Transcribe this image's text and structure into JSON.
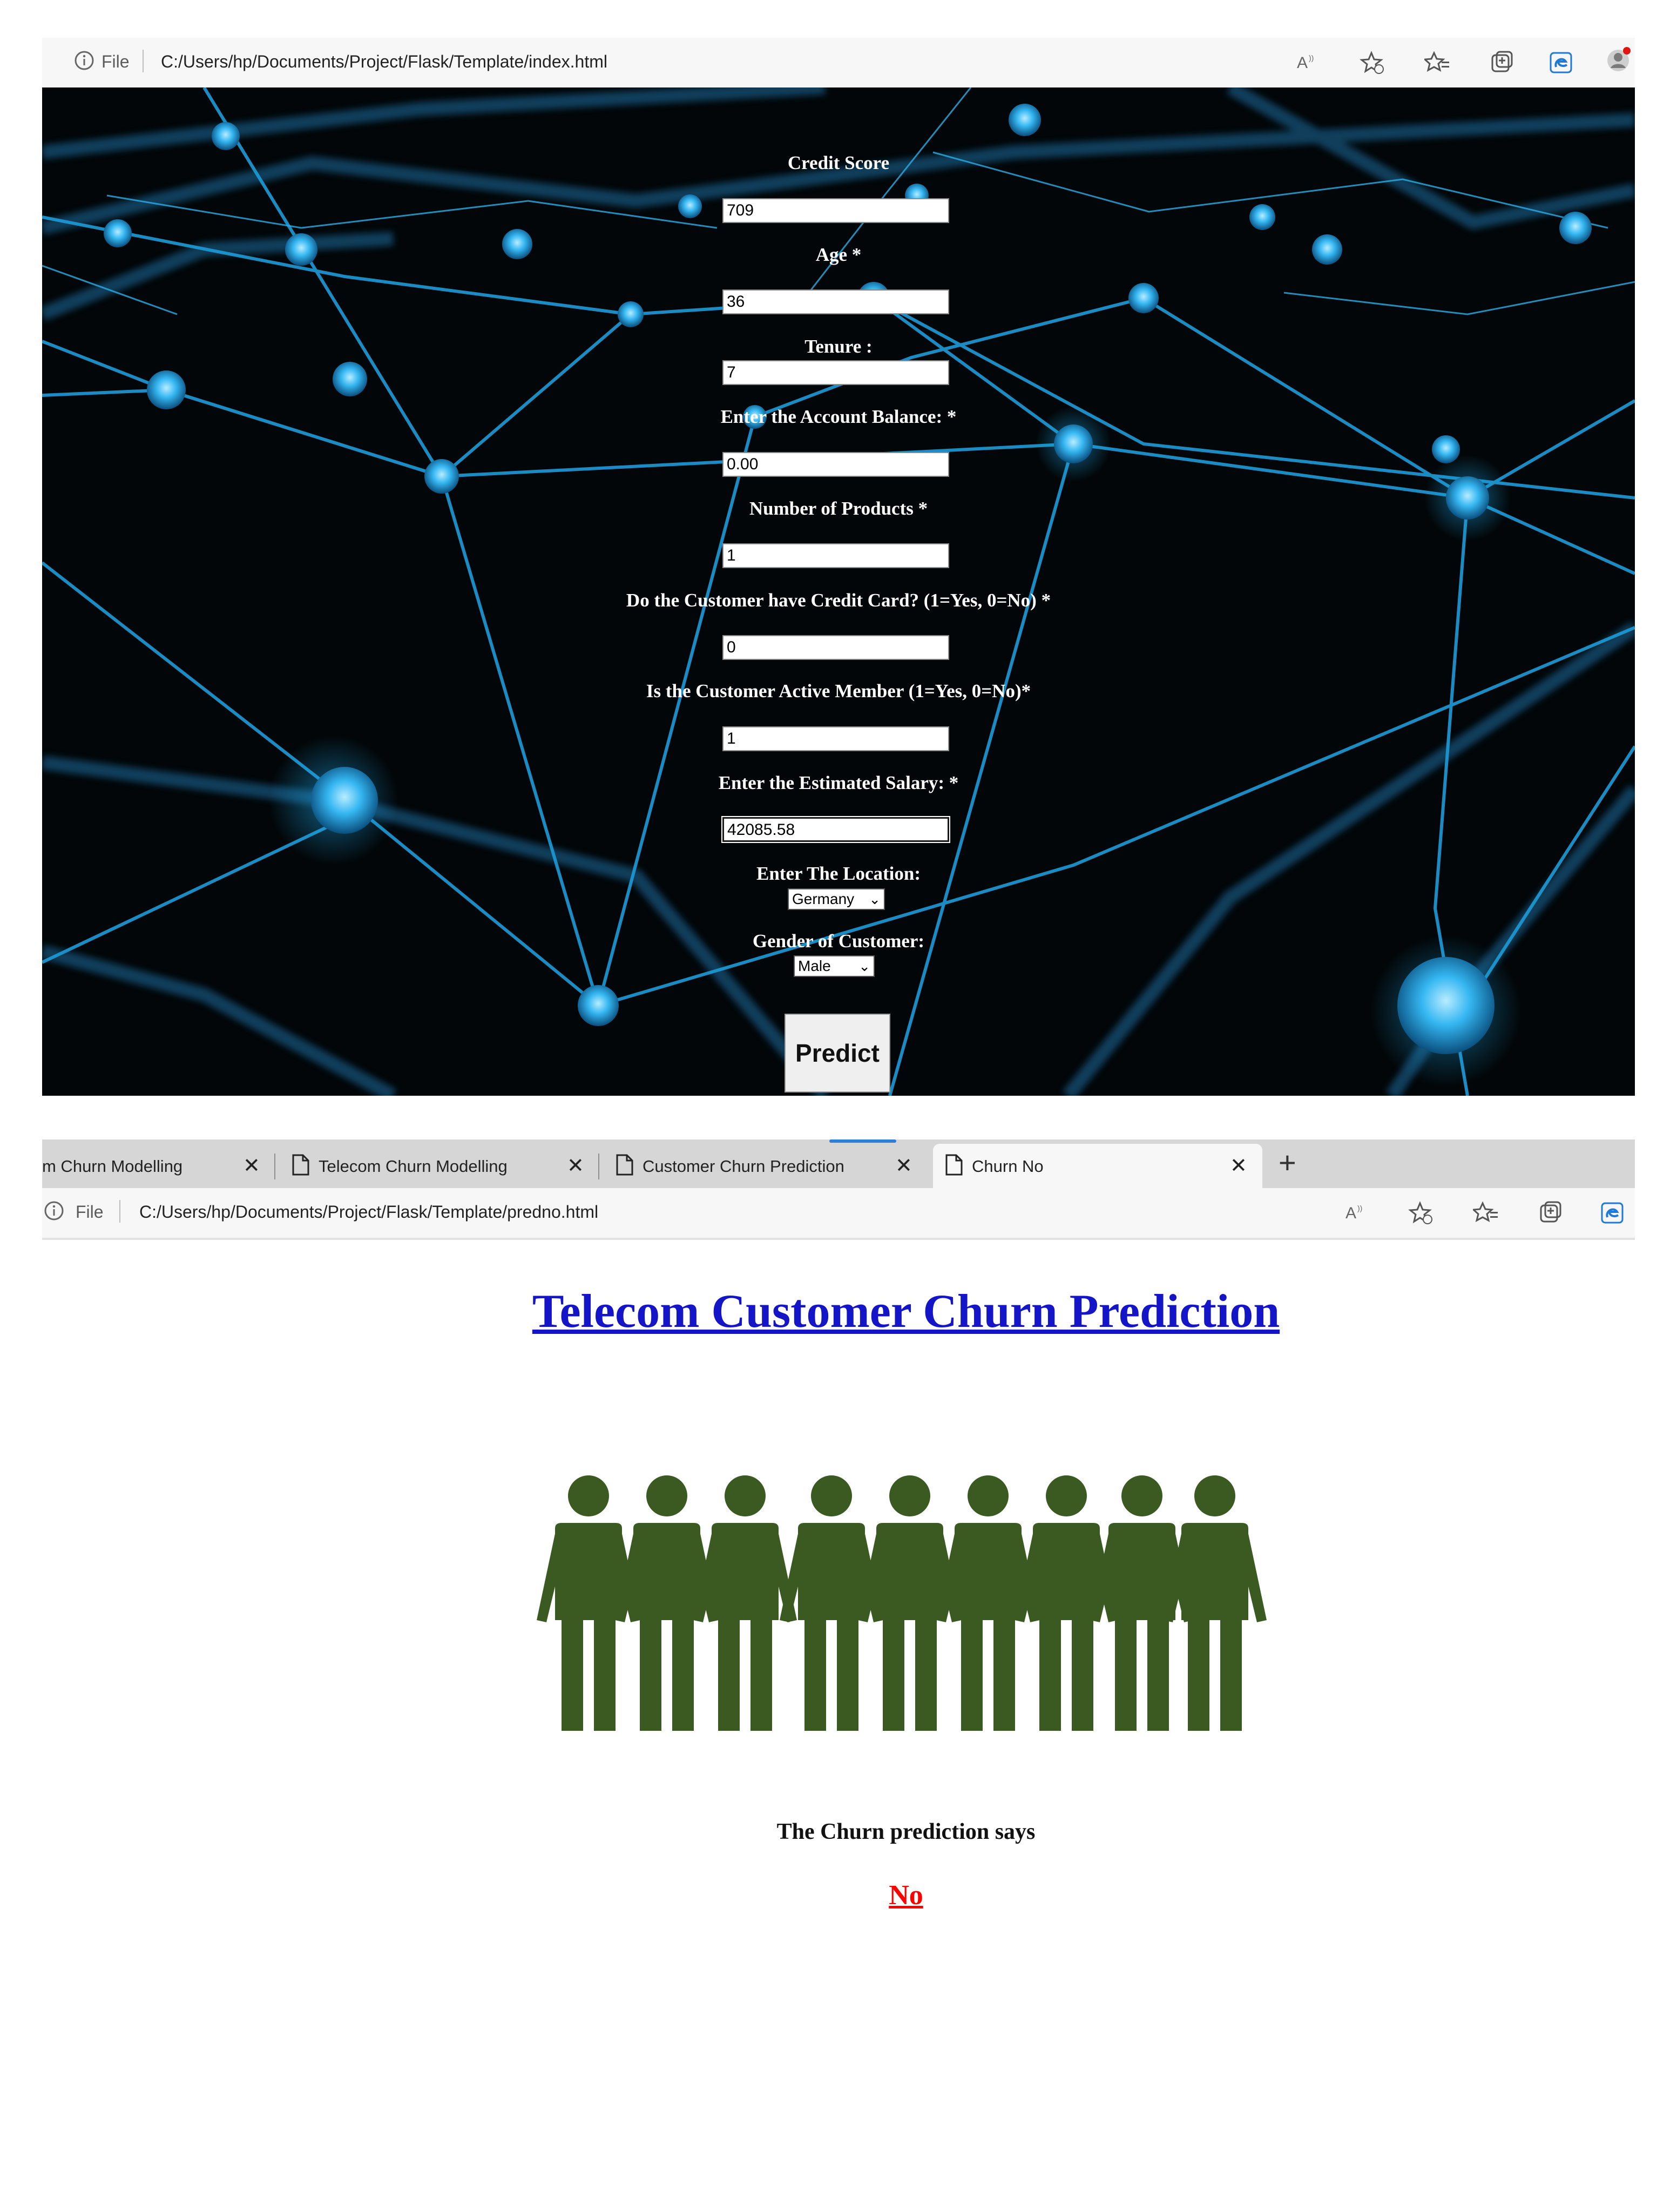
{
  "form_window": {
    "address_bar": {
      "file_label": "File",
      "url": "C:/Users/hp/Documents/Project/Flask/Template/index.html"
    },
    "fields": [
      {
        "label": "Credit Score",
        "value": "709"
      },
      {
        "label": "Age *",
        "value": "36"
      },
      {
        "label": "Tenure :",
        "value": "7"
      },
      {
        "label": "Enter the Account Balance: *",
        "value": "0.00"
      },
      {
        "label": "Number of Products *",
        "value": "1"
      },
      {
        "label": "Do the Customer have Credit Card? (1=Yes, 0=No) *",
        "value": "0"
      },
      {
        "label": "Is the Customer Active Member (1=Yes, 0=No)*",
        "value": "1"
      },
      {
        "label": "Enter the Estimated Salary: *",
        "value": "42085.58"
      }
    ],
    "location": {
      "label": "Enter The Location:",
      "selected": "Germany"
    },
    "gender": {
      "label": "Gender of Customer:",
      "selected": "Male"
    },
    "predict_label": "Predict",
    "toolbar_icons": [
      "read-aloud-icon",
      "add-favorite-icon",
      "favorites-icon",
      "collections-icon",
      "edge-icon",
      "profile-icon"
    ]
  },
  "result_window": {
    "tabs": [
      {
        "title": "m Churn Modelling",
        "active": false
      },
      {
        "title": "Telecom Churn Modelling",
        "active": false
      },
      {
        "title": "Customer Churn Prediction",
        "active": false
      },
      {
        "title": "Churn No",
        "active": true
      }
    ],
    "address_bar": {
      "file_label": "File",
      "url": "C:/Users/hp/Documents/Project/Flask/Template/predno.html"
    },
    "page_title": "Telecom Customer Churn Prediction",
    "prediction_label": "The Churn prediction says",
    "prediction_value": "No",
    "colors": {
      "title_link": "#1515c8",
      "result": "#ff0000",
      "people": "#3a5a22"
    }
  }
}
